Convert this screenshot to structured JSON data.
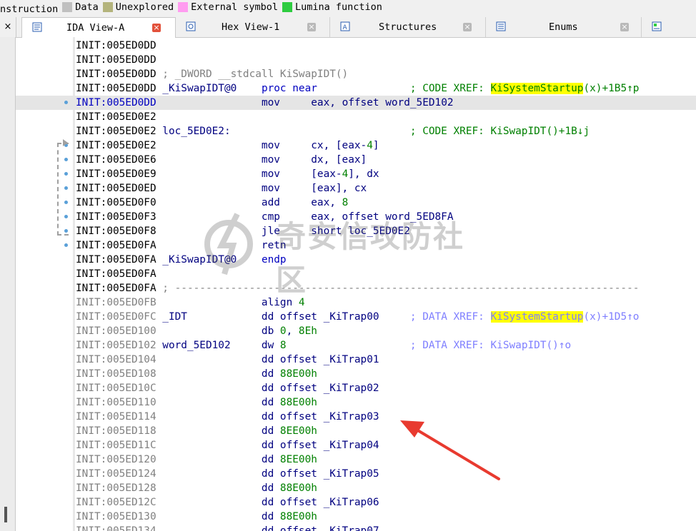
{
  "legend": [
    {
      "label": "nstruction",
      "color": ""
    },
    {
      "label": "Data",
      "color": "#c0c0c0"
    },
    {
      "label": "Unexplored",
      "color": "#b4b47c"
    },
    {
      "label": "External symbol",
      "color": "#ff9cf0"
    },
    {
      "label": "Lumina function",
      "color": "#2ecc40"
    }
  ],
  "tabs": [
    {
      "label": "IDA View-A",
      "active": true,
      "icon": "ida-view-icon"
    },
    {
      "label": "Hex View-1",
      "active": false,
      "icon": "hex-view-icon"
    },
    {
      "label": "Structures",
      "active": false,
      "icon": "structures-icon"
    },
    {
      "label": "Enums",
      "active": false,
      "icon": "enums-icon"
    }
  ],
  "left_close": "×",
  "watermark": "奇安信攻防社区",
  "colors": {
    "highlight": "#ffff00",
    "accent_close": "#e2513b",
    "annotation_arrow": "#e83a2f"
  },
  "lines": [
    {
      "addr": "INIT:005ED0DD",
      "seg": "code",
      "parts": []
    },
    {
      "addr": "INIT:005ED0DD",
      "seg": "code",
      "parts": []
    },
    {
      "addr": "INIT:005ED0DD",
      "seg": "code",
      "parts": [
        {
          "t": " ; _DWORD __stdcall KiSwapIDT()",
          "c": "c-gray"
        }
      ]
    },
    {
      "addr": "INIT:005ED0DD",
      "seg": "code",
      "parts": [
        {
          "t": " _KiSwapIDT@0    ",
          "c": "c-navy"
        },
        {
          "t": "proc near",
          "c": "c-blue"
        },
        {
          "t": "               ; CODE XREF: ",
          "c": "c-cmt"
        },
        {
          "t": "KiSystemStartup",
          "c": "c-cmt hly"
        },
        {
          "t": "(x)+1B5↑p",
          "c": "c-cmt"
        }
      ]
    },
    {
      "addr": "INIT:005ED0DD",
      "seg": "code",
      "hl": true,
      "bullet": true,
      "addrClass": "c-blue",
      "parts": [
        {
          "t": "                 ",
          "c": ""
        },
        {
          "t": "mov     ",
          "c": "c-navy"
        },
        {
          "t": "eax, offset word_5ED102",
          "c": "c-navy"
        }
      ]
    },
    {
      "addr": "INIT:005ED0E2",
      "seg": "code",
      "parts": []
    },
    {
      "addr": "INIT:005ED0E2",
      "seg": "code",
      "parts": [
        {
          "t": " loc_5ED0E2:",
          "c": "c-navy"
        },
        {
          "t": "                             ; CODE XREF: KiSwapIDT()+1B↓j",
          "c": "c-cmt"
        }
      ]
    },
    {
      "addr": "INIT:005ED0E2",
      "seg": "code",
      "bullet": true,
      "parts": [
        {
          "t": "                 mov     cx, [eax-",
          "c": "c-navy"
        },
        {
          "t": "4",
          "c": "c-num"
        },
        {
          "t": "]",
          "c": "c-navy"
        }
      ]
    },
    {
      "addr": "INIT:005ED0E6",
      "seg": "code",
      "bullet": true,
      "parts": [
        {
          "t": "                 mov     dx, [eax]",
          "c": "c-navy"
        }
      ]
    },
    {
      "addr": "INIT:005ED0E9",
      "seg": "code",
      "bullet": true,
      "parts": [
        {
          "t": "                 mov     [eax-",
          "c": "c-navy"
        },
        {
          "t": "4",
          "c": "c-num"
        },
        {
          "t": "], dx",
          "c": "c-navy"
        }
      ]
    },
    {
      "addr": "INIT:005ED0ED",
      "seg": "code",
      "bullet": true,
      "parts": [
        {
          "t": "                 mov     [eax], cx",
          "c": "c-navy"
        }
      ]
    },
    {
      "addr": "INIT:005ED0F0",
      "seg": "code",
      "bullet": true,
      "parts": [
        {
          "t": "                 add     eax, ",
          "c": "c-navy"
        },
        {
          "t": "8",
          "c": "c-num"
        }
      ]
    },
    {
      "addr": "INIT:005ED0F3",
      "seg": "code",
      "bullet": true,
      "parts": [
        {
          "t": "                 cmp     eax, offset word_5ED8FA",
          "c": "c-navy"
        }
      ]
    },
    {
      "addr": "INIT:005ED0F8",
      "seg": "code",
      "bullet": true,
      "parts": [
        {
          "t": "                 jle     short loc_5ED0E2",
          "c": "c-navy"
        }
      ]
    },
    {
      "addr": "INIT:005ED0FA",
      "seg": "code",
      "bullet": true,
      "parts": [
        {
          "t": "                 retn",
          "c": "c-navy"
        }
      ]
    },
    {
      "addr": "INIT:005ED0FA",
      "seg": "code",
      "parts": [
        {
          "t": " _KiSwapIDT@0    ",
          "c": "c-navy"
        },
        {
          "t": "endp",
          "c": "c-blue"
        }
      ]
    },
    {
      "addr": "INIT:005ED0FA",
      "seg": "code",
      "parts": []
    },
    {
      "addr": "INIT:005ED0FA",
      "seg": "code",
      "parts": [
        {
          "t": " ; ---------------------------------------------------------------------------",
          "c": "c-sep"
        }
      ]
    },
    {
      "addr": "INIT:005ED0FB",
      "seg": "data",
      "parts": [
        {
          "t": "                 align ",
          "c": "c-navy"
        },
        {
          "t": "4",
          "c": "c-num"
        }
      ]
    },
    {
      "addr": "INIT:005ED0FC",
      "seg": "data",
      "parts": [
        {
          "t": " _IDT            dd offset _KiTrap00     ",
          "c": "c-navy"
        },
        {
          "t": "; DATA XREF: ",
          "c": "c-lcmt"
        },
        {
          "t": "KiSystemStartup",
          "c": "c-lcmt hly"
        },
        {
          "t": "(x)+1D5↑o",
          "c": "c-lcmt"
        }
      ]
    },
    {
      "addr": "INIT:005ED100",
      "seg": "data",
      "parts": [
        {
          "t": "                 db ",
          "c": "c-navy"
        },
        {
          "t": "0",
          "c": "c-num"
        },
        {
          "t": ", ",
          "c": "c-navy"
        },
        {
          "t": "8Eh",
          "c": "c-num"
        }
      ]
    },
    {
      "addr": "INIT:005ED102",
      "seg": "data",
      "parts": [
        {
          "t": " word_5ED102     dw ",
          "c": "c-navy"
        },
        {
          "t": "8",
          "c": "c-num"
        },
        {
          "t": "                    ; DATA XREF: KiSwapIDT()↑o",
          "c": "c-lcmt"
        }
      ]
    },
    {
      "addr": "INIT:005ED104",
      "seg": "data",
      "parts": [
        {
          "t": "                 dd offset _KiTrap01",
          "c": "c-navy"
        }
      ]
    },
    {
      "addr": "INIT:005ED108",
      "seg": "data",
      "parts": [
        {
          "t": "                 dd ",
          "c": "c-navy"
        },
        {
          "t": "88E00h",
          "c": "c-num"
        }
      ]
    },
    {
      "addr": "INIT:005ED10C",
      "seg": "data",
      "parts": [
        {
          "t": "                 dd offset _KiTrap02",
          "c": "c-navy"
        }
      ]
    },
    {
      "addr": "INIT:005ED110",
      "seg": "data",
      "parts": [
        {
          "t": "                 dd ",
          "c": "c-navy"
        },
        {
          "t": "88E00h",
          "c": "c-num"
        }
      ]
    },
    {
      "addr": "INIT:005ED114",
      "seg": "data",
      "parts": [
        {
          "t": "                 dd offset _KiTrap03",
          "c": "c-navy"
        }
      ]
    },
    {
      "addr": "INIT:005ED118",
      "seg": "data",
      "parts": [
        {
          "t": "                 dd ",
          "c": "c-navy"
        },
        {
          "t": "8EE00h",
          "c": "c-num"
        }
      ]
    },
    {
      "addr": "INIT:005ED11C",
      "seg": "data",
      "parts": [
        {
          "t": "                 dd offset _KiTrap04",
          "c": "c-navy"
        }
      ]
    },
    {
      "addr": "INIT:005ED120",
      "seg": "data",
      "parts": [
        {
          "t": "                 dd ",
          "c": "c-navy"
        },
        {
          "t": "8EE00h",
          "c": "c-num"
        }
      ]
    },
    {
      "addr": "INIT:005ED124",
      "seg": "data",
      "parts": [
        {
          "t": "                 dd offset _KiTrap05",
          "c": "c-navy"
        }
      ]
    },
    {
      "addr": "INIT:005ED128",
      "seg": "data",
      "parts": [
        {
          "t": "                 dd ",
          "c": "c-navy"
        },
        {
          "t": "88E00h",
          "c": "c-num"
        }
      ]
    },
    {
      "addr": "INIT:005ED12C",
      "seg": "data",
      "parts": [
        {
          "t": "                 dd offset _KiTrap06",
          "c": "c-navy"
        }
      ]
    },
    {
      "addr": "INIT:005ED130",
      "seg": "data",
      "parts": [
        {
          "t": "                 dd ",
          "c": "c-navy"
        },
        {
          "t": "88E00h",
          "c": "c-num"
        }
      ]
    },
    {
      "addr": "INIT:005ED134",
      "seg": "data",
      "parts": [
        {
          "t": "                 dd offset _KiTrap07",
          "c": "c-navy"
        }
      ]
    }
  ]
}
